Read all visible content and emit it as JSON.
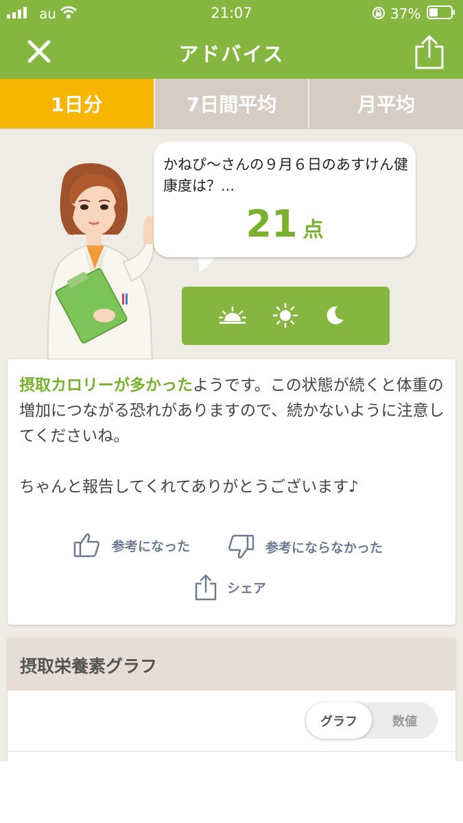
{
  "status_bar": {
    "carrier": "au",
    "time": "21:07",
    "battery_percent": "37%"
  },
  "nav": {
    "title": "アドバイス",
    "close_icon": "close-icon",
    "share_icon": "share-icon"
  },
  "tabs": [
    {
      "label": "1日分",
      "active": true
    },
    {
      "label": "7日間平均",
      "active": false
    },
    {
      "label": "月平均",
      "active": false
    }
  ],
  "bubble": {
    "text": "かねぴ〜さんの９月６日のあすけん健康度は？...",
    "score": "21",
    "score_unit": "点"
  },
  "time_of_day_icons": [
    "sunrise-icon",
    "sun-icon",
    "moon-icon"
  ],
  "advice": {
    "highlight": "摂取カロリーが多かった",
    "text_after_highlight": "ようです。この状態が続くと体重の増加につながる恐れがありますので、続かないように注意してくださいね。",
    "thanks": "ちゃんと報告してくれてありがとうございます♪"
  },
  "actions": {
    "helpful": "参考になった",
    "not_helpful": "参考にならなかった",
    "share": "シェア"
  },
  "nutrient_graph": {
    "title": "摂取栄養素グラフ",
    "toggle": [
      "グラフ",
      "数値"
    ],
    "selected": "グラフ"
  },
  "colors": {
    "brand_green": "#85b63f",
    "active_tab": "#f7b500",
    "inactive_tab": "#d5ccc4",
    "highlight_text": "#7ab030",
    "background": "#efece6"
  }
}
